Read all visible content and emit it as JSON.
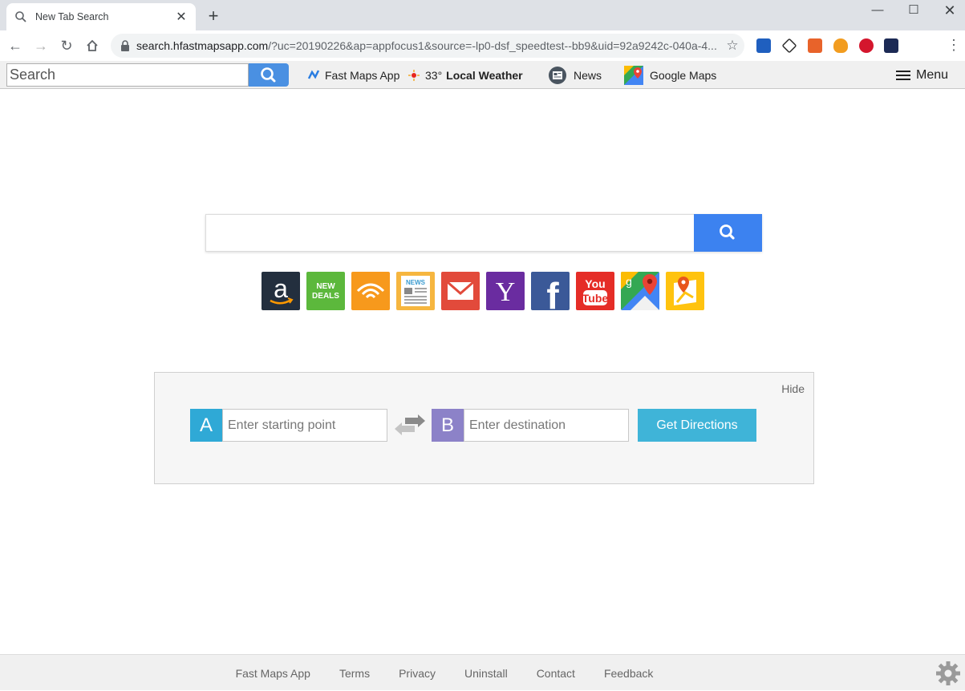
{
  "browser": {
    "tab_title": "New Tab Search",
    "url_host": "search.hfastmapsapp.com",
    "url_rest": "/?uc=20190226&ap=appfocus1&source=-lp0-dsf_speedtest--bb9&uid=92a9242c-040a-4..."
  },
  "bookbar": {
    "search_placeholder": "Search",
    "links": [
      {
        "label": "Fast Maps App",
        "icon": "fast-maps-icon"
      },
      {
        "label": "33°",
        "bold": "Local Weather",
        "icon": "weather-icon"
      },
      {
        "label": "News",
        "icon": "news-icon"
      },
      {
        "label": "Google Maps",
        "icon": "google-maps-icon"
      }
    ],
    "menu_label": "Menu"
  },
  "main": {
    "search_placeholder": "",
    "tiles": [
      {
        "name": "amazon",
        "color": "#232f3e"
      },
      {
        "name": "new-deals",
        "color": "#5cb83c",
        "text": "NEW DEALS"
      },
      {
        "name": "audible",
        "color": "#f7991c"
      },
      {
        "name": "news",
        "color": "#f6b63f",
        "text": "NEWS"
      },
      {
        "name": "gmail",
        "color": "#e24a3b"
      },
      {
        "name": "yahoo",
        "color": "#6a2ca0",
        "text": "Y"
      },
      {
        "name": "facebook",
        "color": "#3b5998",
        "text": "f"
      },
      {
        "name": "youtube",
        "color": "#e52d27",
        "text": "You Tube"
      },
      {
        "name": "google-maps",
        "color": "#ffffff"
      },
      {
        "name": "maps-app",
        "color": "#ffc30f"
      }
    ]
  },
  "directions": {
    "hide_label": "Hide",
    "a_badge": "A",
    "a_placeholder": "Enter starting point",
    "b_badge": "B",
    "b_placeholder": "Enter destination",
    "button_label": "Get Directions",
    "a_color": "#2fa9d6",
    "b_color": "#8c82c8"
  },
  "footer": {
    "links": [
      "Fast Maps App",
      "Terms",
      "Privacy",
      "Uninstall",
      "Contact",
      "Feedback"
    ]
  }
}
